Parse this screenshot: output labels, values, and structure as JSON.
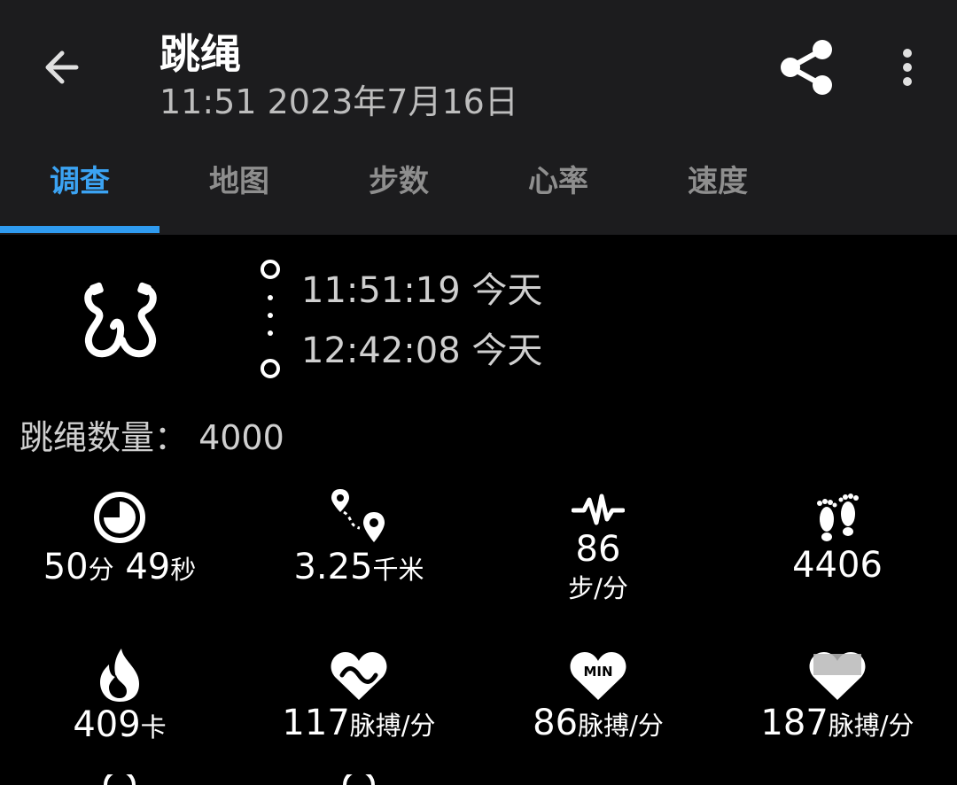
{
  "header": {
    "title": "跳绳",
    "subtitle": "11:51 2023年7月16日",
    "icons": [
      "back-arrow-icon",
      "share-icon",
      "more-vertical-icon"
    ]
  },
  "tabs": [
    {
      "label": "调查",
      "active": true
    },
    {
      "label": "地图",
      "active": false
    },
    {
      "label": "步数",
      "active": false
    },
    {
      "label": "心率",
      "active": false
    },
    {
      "label": "速度",
      "active": false
    }
  ],
  "session": {
    "start": "11:51:19 今天",
    "end": "12:42:08 今天",
    "count_line": "跳绳数量： 4000"
  },
  "stats": [
    {
      "icon": "clock-icon",
      "value": "50",
      "unit": "分",
      "value2": "49",
      "unit2": "秒"
    },
    {
      "icon": "route-icon",
      "value": "3.25",
      "unit": "千米"
    },
    {
      "icon": "pulse-icon",
      "value": "86",
      "sub": "步/分"
    },
    {
      "icon": "footprints-icon",
      "value": "4406"
    },
    {
      "icon": "fire-icon",
      "value": "409",
      "unit": "卡"
    },
    {
      "icon": "heart-wave-icon",
      "value": "117",
      "unit": "脉搏/分"
    },
    {
      "icon": "heart-min-icon",
      "value": "86",
      "unit": "脉搏/分",
      "icon_label": "MIN"
    },
    {
      "icon": "heart-max-icon",
      "value": "187",
      "unit": "脉搏/分"
    }
  ],
  "colors": {
    "accent": "#2f9bf0",
    "header_bg": "#1c1c1e",
    "body_bg": "#000000"
  }
}
